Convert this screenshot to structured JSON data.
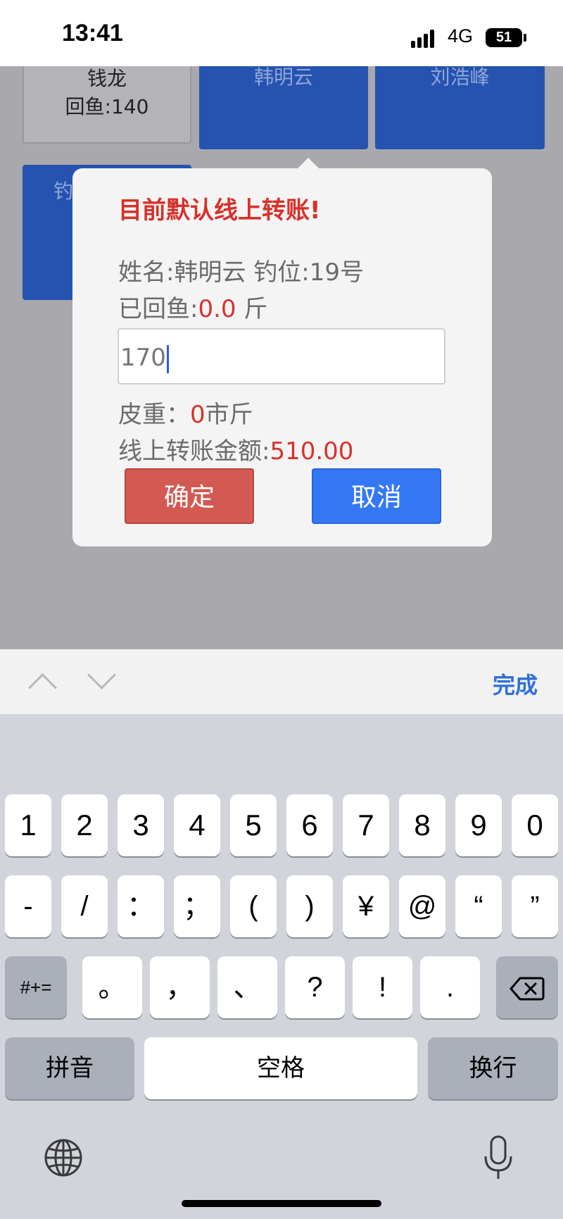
{
  "status_bar": {
    "time": "13:41",
    "network": "4G",
    "battery": "51"
  },
  "background_tiles": [
    {
      "line1": "钱龙",
      "line2": "回鱼:140"
    },
    {
      "line1": "韩明云",
      "line2": ""
    },
    {
      "line1": "刘浩峰",
      "line2": ""
    },
    {
      "line1": "钓",
      "line2": ""
    }
  ],
  "dialog": {
    "title": "目前默认线上转账!",
    "name_line": "姓名:韩明云 钓位:19号",
    "caught_label": "已回鱼:",
    "caught_value": "0.0",
    "caught_unit": " 斤",
    "input_value": "170",
    "tare_label": "皮重：",
    "tare_value": "0",
    "tare_unit": "市斤",
    "amount_label": "线上转账金额:",
    "amount_value": "510.00",
    "confirm_label": "确定",
    "cancel_label": "取消"
  },
  "accessory_bar": {
    "done_label": "完成",
    "prev_icon": "chevron-up-icon",
    "next_icon": "chevron-down-icon"
  },
  "keyboard": {
    "row1": [
      "1",
      "2",
      "3",
      "4",
      "5",
      "6",
      "7",
      "8",
      "9",
      "0"
    ],
    "row2": [
      "-",
      "/",
      "：",
      "；",
      "(",
      ")",
      "¥",
      "@",
      "“",
      "”"
    ],
    "row3_left": "#+=",
    "row3": [
      "。",
      "，",
      "、",
      "?",
      "!",
      "."
    ],
    "delete_icon": "backspace-icon",
    "pinyin_label": "拼音",
    "space_label": "空格",
    "return_label": "换行",
    "globe_icon": "globe-icon",
    "mic_icon": "microphone-icon"
  },
  "colors": {
    "accent_red": "#d6312a",
    "confirm": "#d35a52",
    "cancel": "#3478f6",
    "tile_blue": "#2653b0",
    "done": "#2e6fd9"
  }
}
